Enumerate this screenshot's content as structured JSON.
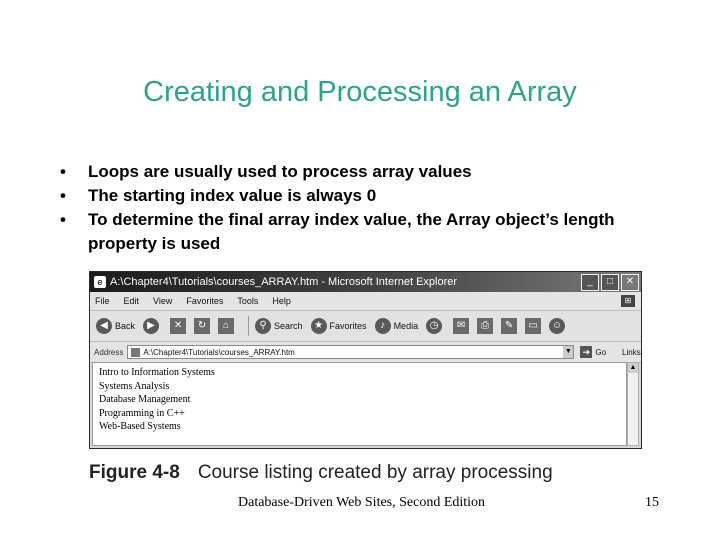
{
  "slide": {
    "title": "Creating and Processing an Array",
    "bullets": [
      "Loops are usually used to process array values",
      "The starting index value is always 0",
      "To determine the final array index value, the Array object’s length property is used"
    ],
    "bullet_symbol": "•",
    "title_color": "#2aa58a"
  },
  "browser": {
    "title": "A:\\Chapter4\\Tutorials\\courses_ARRAY.htm - Microsoft Internet Explorer",
    "menu": [
      "File",
      "Edit",
      "View",
      "Favorites",
      "Tools",
      "Help"
    ],
    "toolbar": {
      "back_label": "Back",
      "search_label": "Search",
      "favorites_label": "Favorites",
      "media_label": "Media"
    },
    "address_label": "Address",
    "address_value": "A:\\Chapter4\\Tutorials\\courses_ARRAY.htm",
    "go_label": "Go",
    "links_label": "Links",
    "courses": [
      "Intro to Information Systems",
      "Systems Analysis",
      "Database Management",
      "Programming in C++",
      "Web-Based Systems"
    ]
  },
  "figure": {
    "number": "Figure 4-8",
    "caption": "Course listing created by array processing"
  },
  "footer": {
    "text": "Database-Driven Web Sites, Second Edition",
    "page_number": "15"
  }
}
